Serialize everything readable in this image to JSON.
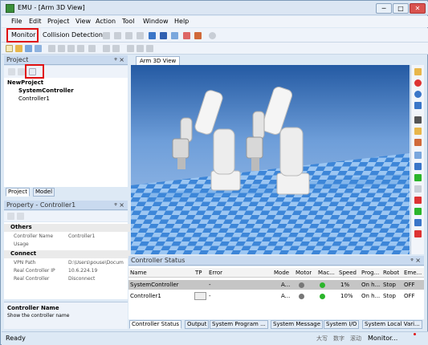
{
  "window": {
    "title": "EMU - [Arm 3D View]",
    "min": "─",
    "max": "□",
    "close": "✕"
  },
  "menu": [
    "File",
    "Edit",
    "Project",
    "View",
    "Action",
    "Tool",
    "Window",
    "Help"
  ],
  "toolbar": {
    "monitor": "Monitor",
    "collision": "Collision Detection"
  },
  "project_panel": {
    "title": "Project",
    "pin": "ᵠ ×",
    "tree": [
      "NewProject",
      "SystemController",
      "Controller1"
    ],
    "tabs": [
      "Project",
      "Model"
    ]
  },
  "property_panel": {
    "title": "Property - Controller1",
    "pin": "ᵠ ×",
    "categories": {
      "others": "Others",
      "connect": "Connect"
    },
    "rows": {
      "controller_name": {
        "label": "Controller Name",
        "value": "Controller1"
      },
      "usage": {
        "label": "Usage",
        "value": ""
      },
      "vpn_path": {
        "label": "VPN Path",
        "value": "D:\\Users\\pouse\\Docum"
      },
      "real_controller_ip": {
        "label": "Real Controller IP",
        "value": "10.6.224.19"
      },
      "real_controller": {
        "label": "Real Controller",
        "value": "Disconnect"
      }
    },
    "desc_title": "Controller Name",
    "desc_text": "Show the controller name"
  },
  "view_tab": {
    "label": "Arm 3D View"
  },
  "controller_status": {
    "title": "Controller Status",
    "pin": "ᵠ ×",
    "columns": [
      "Name",
      "TP",
      "Error",
      "Mode",
      "Motor",
      "Mac...",
      "Speed",
      "Prog...",
      "Robot",
      "Eme..."
    ],
    "rows": [
      {
        "name": "SystemController",
        "tp": "",
        "error": "-",
        "mode": "A...",
        "speed": "1%",
        "prog": "On h...",
        "robot": "Stop",
        "eme": "OFF"
      },
      {
        "name": "Controller1",
        "tp": "",
        "error": "-",
        "mode": "A...",
        "speed": "10%",
        "prog": "On h...",
        "robot": "Stop",
        "eme": "OFF"
      }
    ],
    "tabs": [
      "Controller Status",
      "Output",
      "System Program ...",
      "System Message",
      "System I/O",
      "System Local Vari..."
    ]
  },
  "status": {
    "left": "Ready",
    "r1": "大写",
    "r2": "数字",
    "r3": "滚动",
    "r4": "Monitor..."
  },
  "colors": {
    "accent": "#3a76c8",
    "highlight": "#e01010",
    "motor_on": "#2bb52b",
    "floor_a": "#3d86d8",
    "floor_b": "#9cc6f2"
  }
}
